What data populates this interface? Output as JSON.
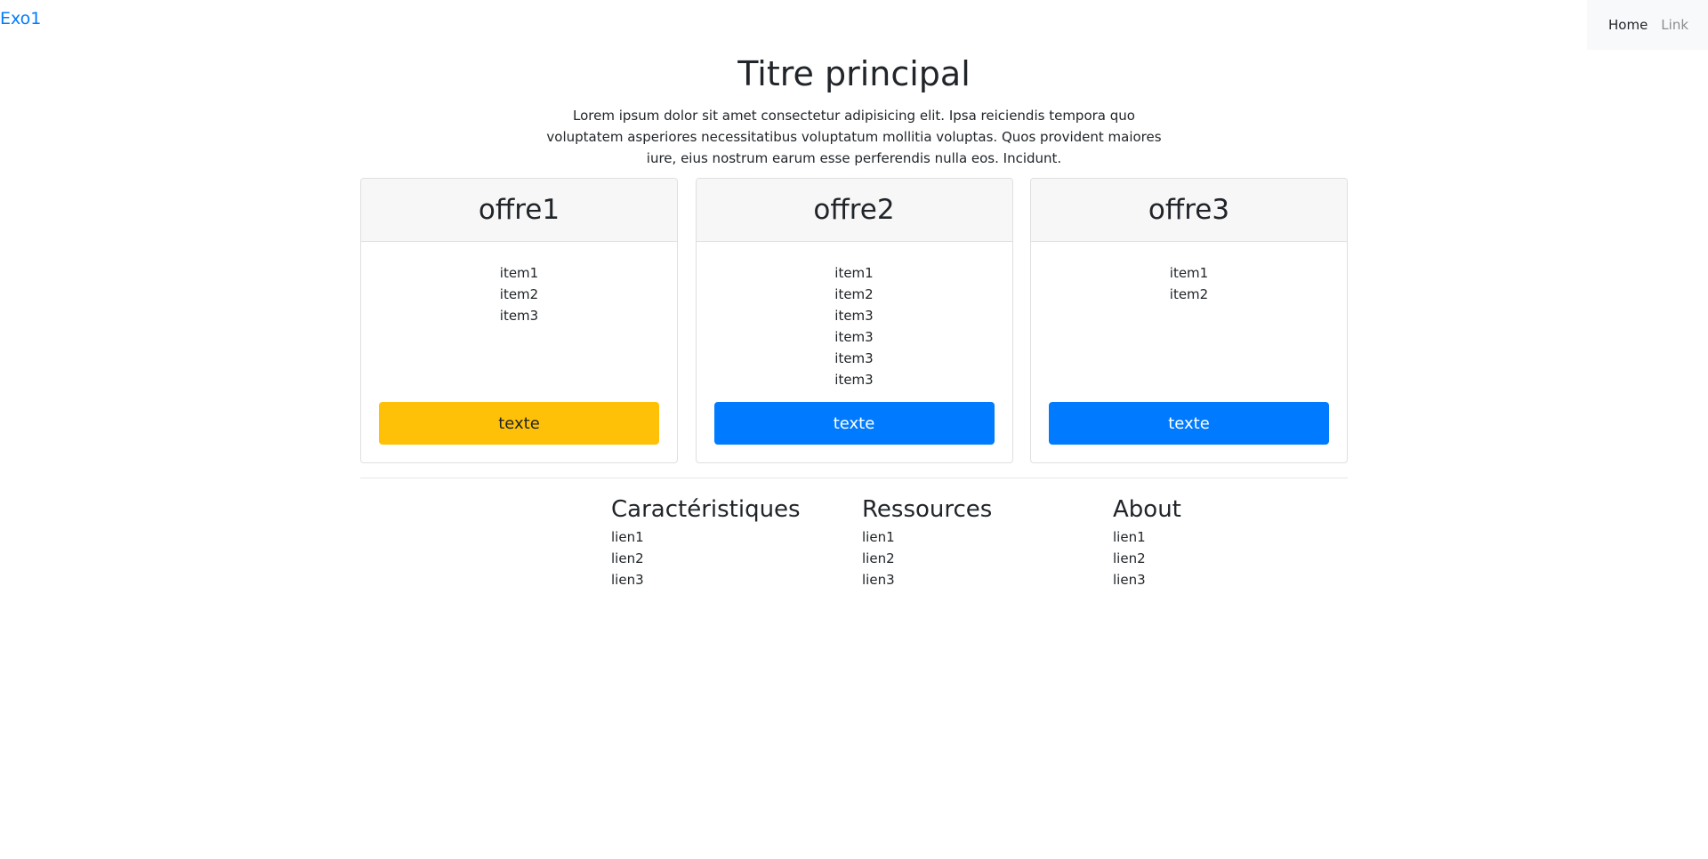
{
  "brand": "Exo1",
  "nav": {
    "home": "Home",
    "link": "Link"
  },
  "hero": {
    "title": "Titre principal",
    "text": "Lorem ipsum dolor sit amet consectetur adipisicing elit. Ipsa reiciendis tempora quo voluptatem asperiores necessitatibus voluptatum mollitia voluptas. Quos provident maiores iure, eius nostrum earum esse perferendis nulla eos. Incidunt."
  },
  "offers": [
    {
      "title": "offre1",
      "items": [
        "item1",
        "item2",
        "item3"
      ],
      "button": "texte",
      "button_color": "#ffc107"
    },
    {
      "title": "offre2",
      "items": [
        "item1",
        "item2",
        "item3",
        "item3",
        "item3",
        "item3"
      ],
      "button": "texte",
      "button_color": "#007bff"
    },
    {
      "title": "offre3",
      "items": [
        "item1",
        "item2"
      ],
      "button": "texte",
      "button_color": "#007bff"
    }
  ],
  "footer": [
    {
      "title": "Caractéristiques",
      "links": [
        "lien1",
        "lien2",
        "lien3"
      ]
    },
    {
      "title": "Ressources",
      "links": [
        "lien1",
        "lien2",
        "lien3"
      ]
    },
    {
      "title": "About",
      "links": [
        "lien1",
        "lien2",
        "lien3"
      ]
    }
  ]
}
